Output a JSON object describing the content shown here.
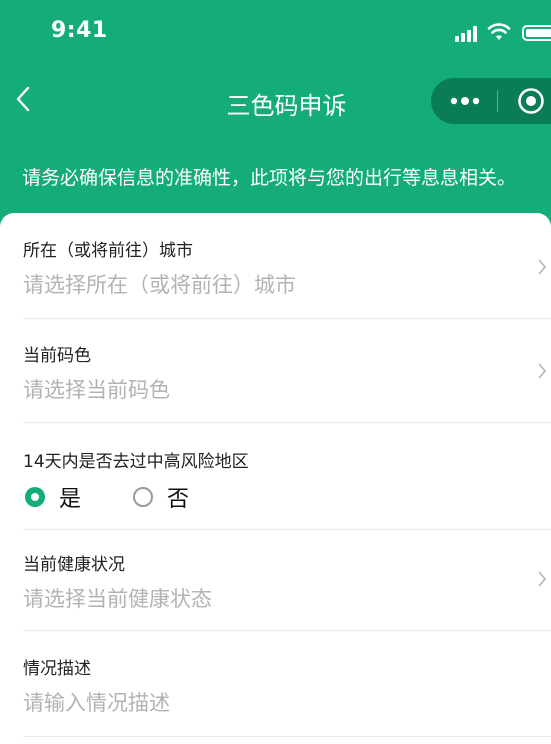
{
  "status_bar": {
    "time": "9:41"
  },
  "nav": {
    "title": "三色码申诉"
  },
  "notice": "请务必确保信息的准确性，此项将与您的出行等息息相关。",
  "form": {
    "city": {
      "label": "所在（或将前往）城市",
      "placeholder": "请选择所在（或将前往）城市"
    },
    "code_color": {
      "label": "当前码色",
      "placeholder": "请选择当前码色"
    },
    "risk_area": {
      "label": "14天内是否去过中高风险地区",
      "options": [
        "是",
        "否"
      ],
      "selected": "是"
    },
    "health": {
      "label": "当前健康状况",
      "placeholder": "请选择当前健康状态"
    },
    "description": {
      "label": "情况描述",
      "placeholder": "请输入情况描述"
    }
  },
  "colors": {
    "brand": "#13ac7a",
    "capsule": "#0b7d56",
    "placeholder": "#b3b3b3"
  }
}
